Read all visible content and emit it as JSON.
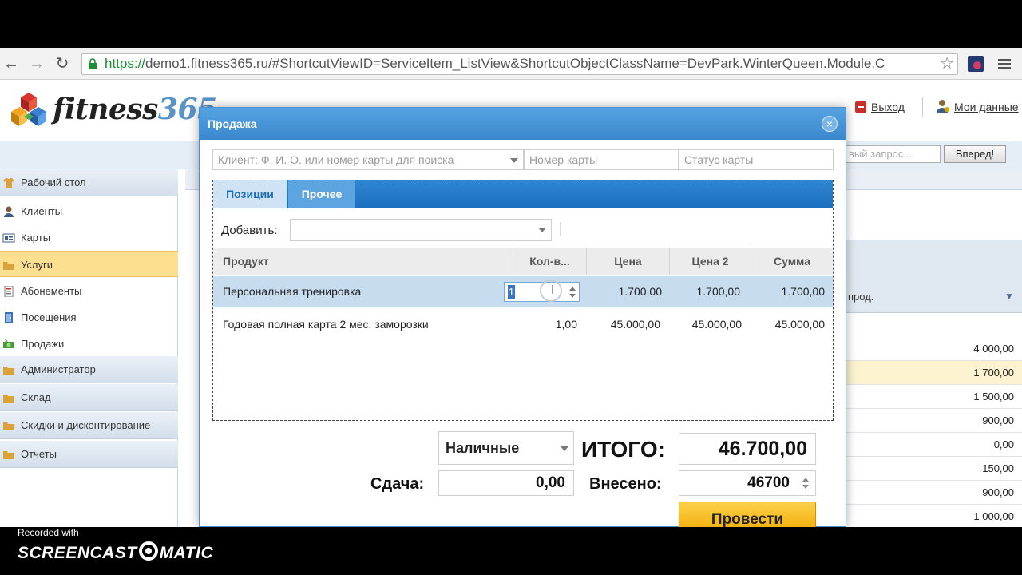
{
  "browser": {
    "url_prefix": "https://",
    "url_rest": "demo1.fitness365.ru/#ShortcutViewID=ServiceItem_ListView&ShortcutObjectClassName=DevPark.WinterQueen.Module.C"
  },
  "header": {
    "logo_word": "fitness",
    "logo_num": "365",
    "logout_label": "Выход",
    "mydata_label": "Мои данные",
    "search_placeholder": "вый запрос...",
    "forward_label": "Вперед!"
  },
  "sidebar": {
    "items": [
      {
        "label": "Рабочий стол",
        "type": "group"
      },
      {
        "label": "Клиенты",
        "type": "item"
      },
      {
        "label": "Карты",
        "type": "item"
      },
      {
        "label": "Услуги",
        "type": "item"
      },
      {
        "label": "Абонементы",
        "type": "item"
      },
      {
        "label": "Посещения",
        "type": "item"
      },
      {
        "label": "Продажи",
        "type": "item"
      },
      {
        "label": "Администратор",
        "type": "group"
      },
      {
        "label": "Склад",
        "type": "group"
      },
      {
        "label": "Скидки и дисконтирование",
        "type": "group"
      },
      {
        "label": "Отчеты",
        "type": "group"
      }
    ]
  },
  "background_grid": {
    "column_label": "прод.",
    "values": [
      "4 000,00",
      "1 700,00",
      "1 500,00",
      "900,00",
      "0,00",
      "150,00",
      "900,00",
      "1 000,00"
    ]
  },
  "modal": {
    "title": "Продажа",
    "client_placeholder": "Клиент: Ф. И. О. или номер карты для поиска",
    "card_number_placeholder": "Номер карты",
    "card_status_placeholder": "Статус карты",
    "tabs": [
      "Позиции",
      "Прочее"
    ],
    "add_label": "Добавить:",
    "columns": [
      "Продукт",
      "Кол-в...",
      "Цена",
      "Цена 2",
      "Сумма"
    ],
    "rows": [
      {
        "product": "Персональная тренировка",
        "qty": "1",
        "price": "1.700,00",
        "price2": "1.700,00",
        "sum": "1.700,00"
      },
      {
        "product": "Годовая полная карта 2 мес. заморозки",
        "qty": "1,00",
        "price": "45.000,00",
        "price2": "45.000,00",
        "sum": "45.000,00"
      }
    ],
    "payment_method": "Наличные",
    "total_label": "ИТОГО:",
    "total_value": "46.700,00",
    "change_label": "Сдача:",
    "change_value": "0,00",
    "paid_label": "Внесено:",
    "paid_value": "46700",
    "submit_label": "Провести"
  },
  "watermark": {
    "line1": "Recorded with",
    "line2": "SCREENCAST",
    "line3": "MATIC"
  },
  "colors": {
    "accent_blue": "#3a88cc",
    "active_nav": "#fde08f",
    "submit_orange": "#f2a800"
  }
}
